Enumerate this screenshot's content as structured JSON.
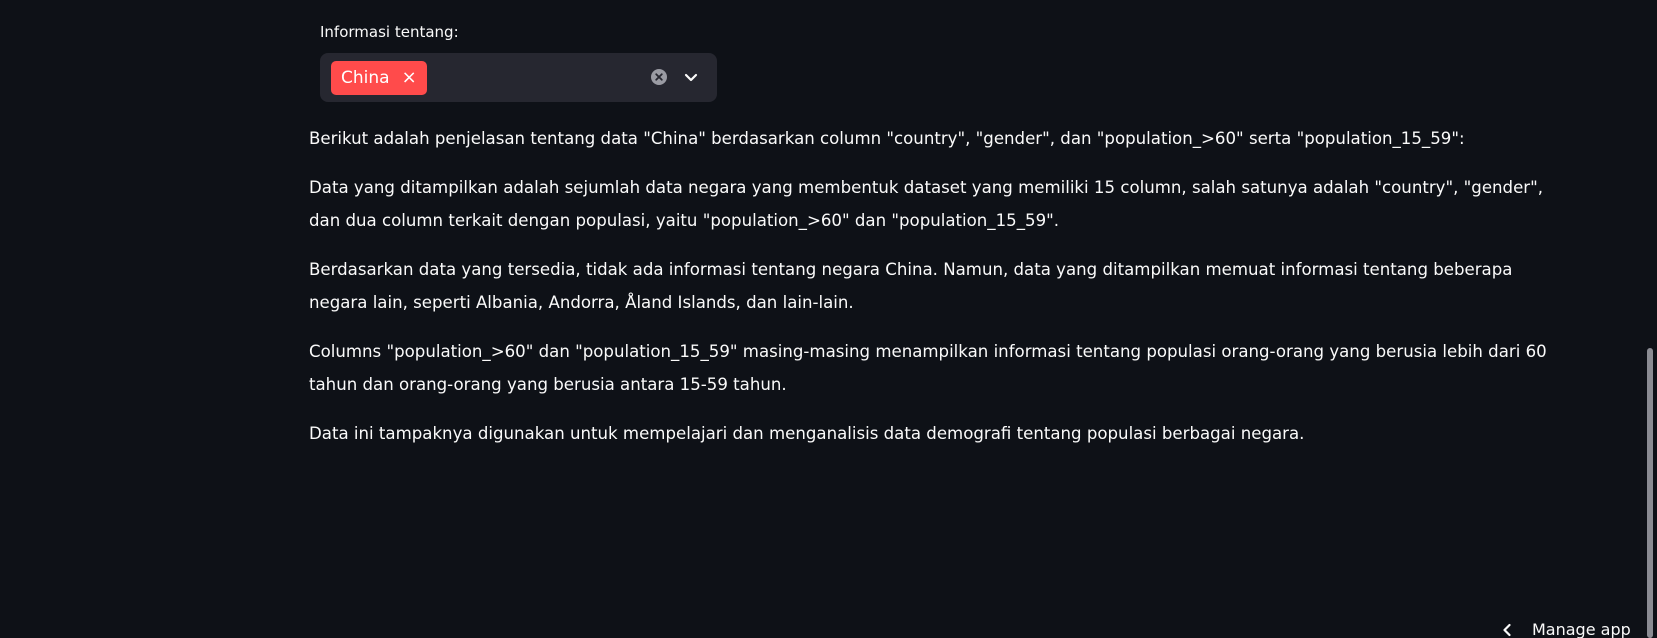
{
  "select": {
    "label": "Informasi tentang:",
    "selected_tag": "China",
    "tag_close_glyph": "×",
    "clear_icon": "clear-circle-icon",
    "dropdown_icon": "chevron-down-icon",
    "tag_color": "#ff4b4b"
  },
  "content": {
    "paragraphs": [
      "Berikut adalah penjelasan tentang data \"China\" berdasarkan column \"country\", \"gender\", dan \"population_>60\" serta \"population_15_59\":",
      "Data yang ditampilkan adalah sejumlah data negara yang membentuk dataset yang memiliki 15 column, salah satunya adalah \"country\", \"gender\", dan dua column terkait dengan populasi, yaitu \"population_>60\" dan \"population_15_59\".",
      "Berdasarkan data yang tersedia, tidak ada informasi tentang negara China. Namun, data yang ditampilkan memuat informasi tentang beberapa negara lain, seperti Albania, Andorra, Åland Islands, dan lain-lain.",
      "Columns \"population_>60\" dan \"population_15_59\" masing-masing menampilkan informasi tentang populasi orang-orang yang berusia lebih dari 60 tahun dan orang-orang yang berusia antara 15-59 tahun.",
      "Data ini tampaknya digunakan untuk mempelajari dan menganalisis data demografi tentang populasi berbagai negara."
    ]
  },
  "footer": {
    "manage_app_label": "Manage app",
    "manage_app_icon": "chevron-left-icon"
  },
  "colors": {
    "background": "#0e1117",
    "input_background": "#262730",
    "text": "#fafafa"
  }
}
